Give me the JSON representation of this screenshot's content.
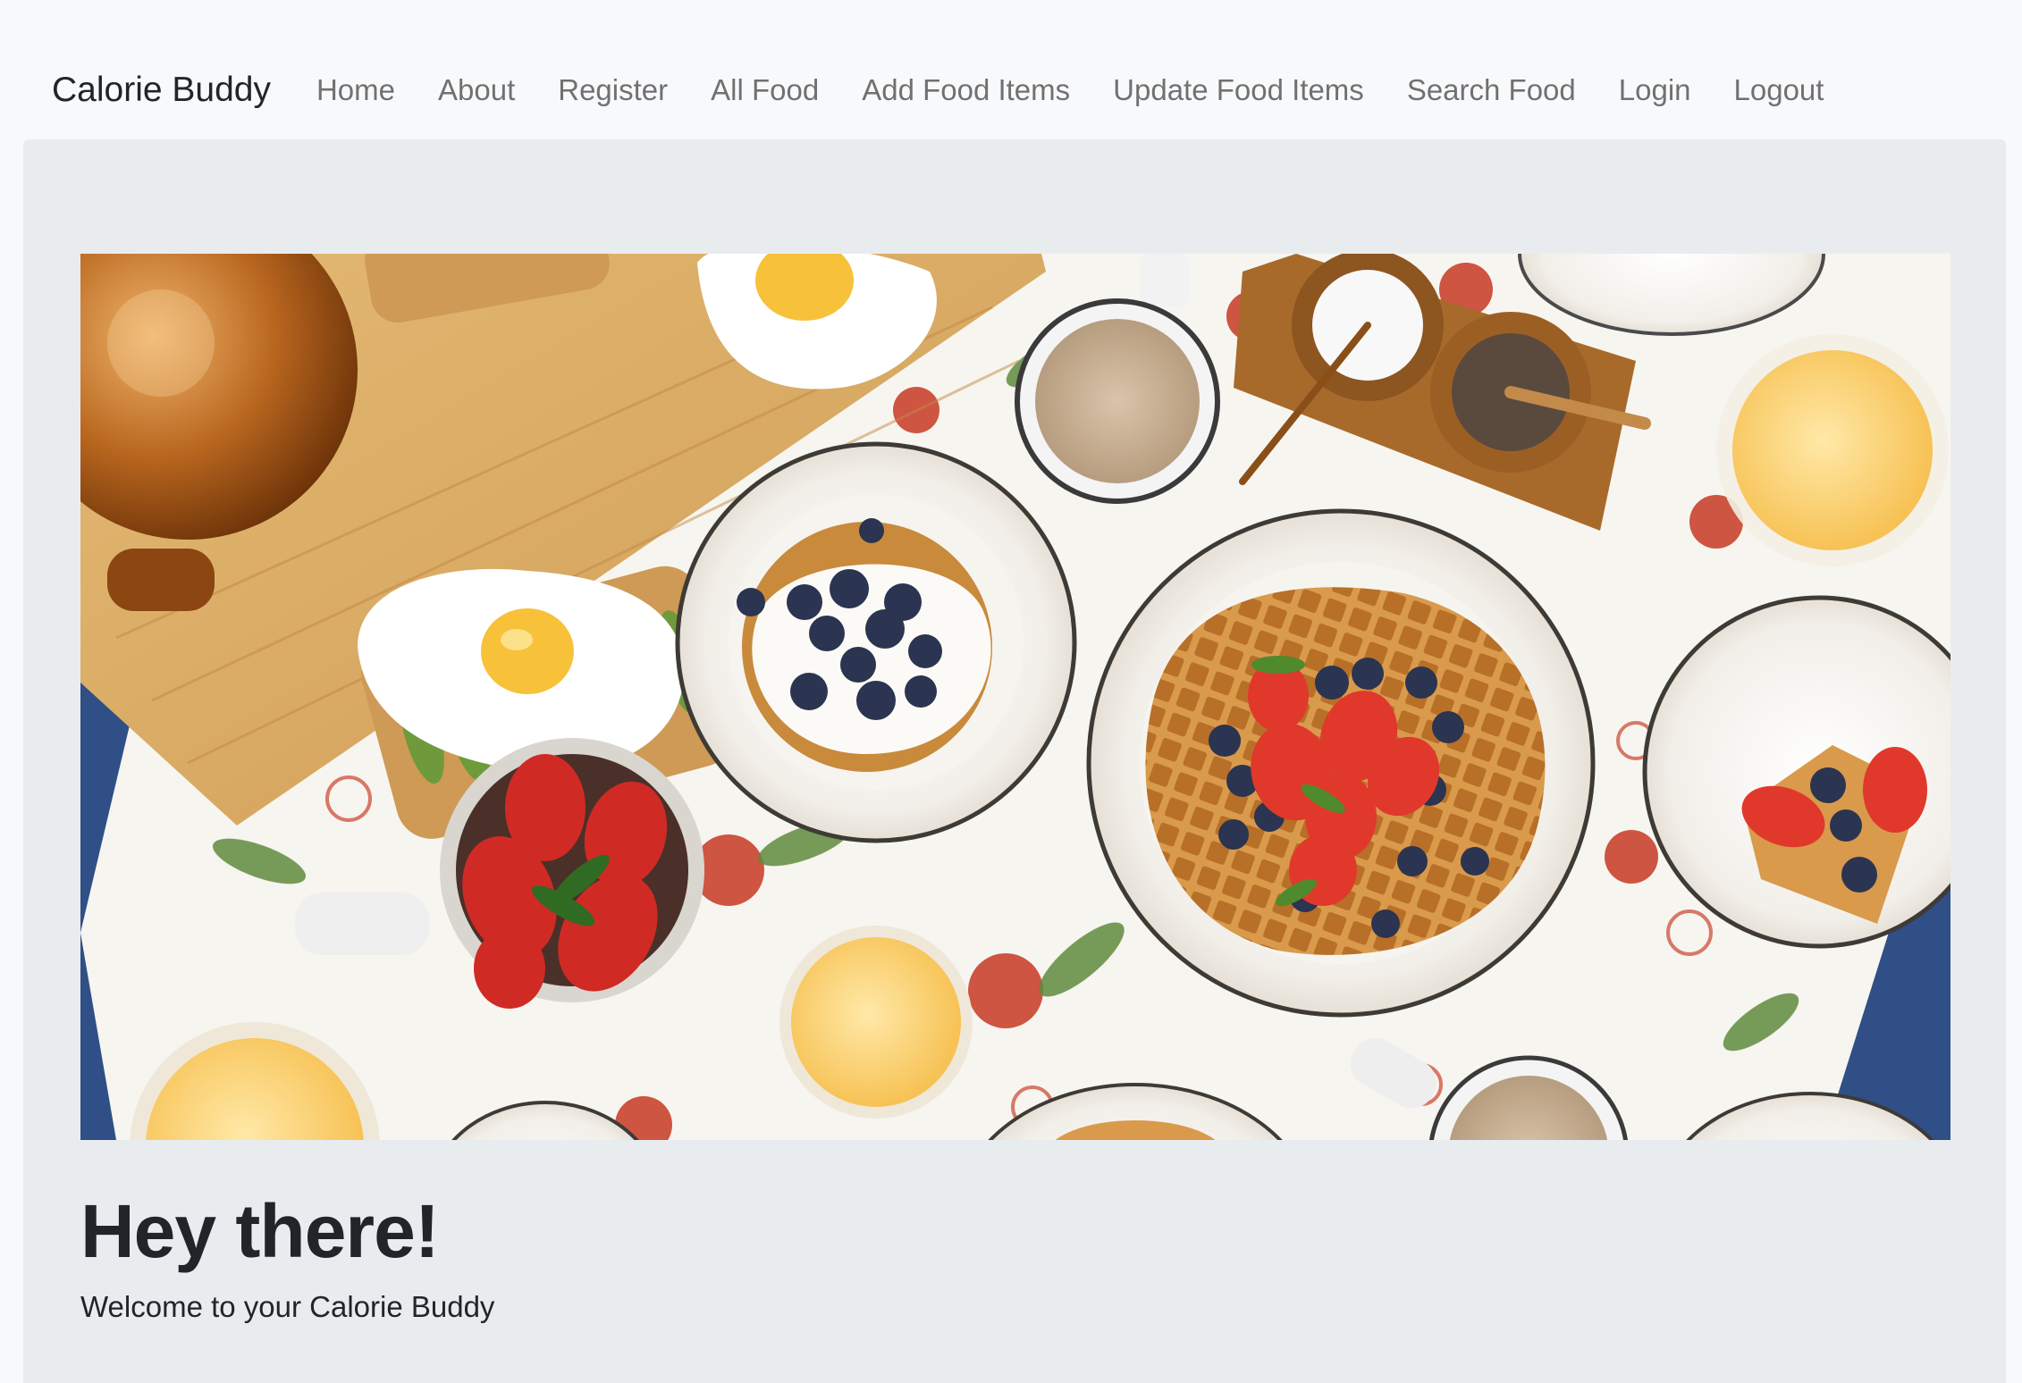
{
  "navbar": {
    "brand": "Calorie Buddy",
    "links": [
      {
        "label": "Home"
      },
      {
        "label": "About"
      },
      {
        "label": "Register"
      },
      {
        "label": "All Food"
      },
      {
        "label": "Add Food Items"
      },
      {
        "label": "Update Food Items"
      },
      {
        "label": "Search Food"
      },
      {
        "label": "Login"
      },
      {
        "label": "Logout"
      }
    ]
  },
  "hero": {
    "heading": "Hey there!",
    "subtext": "Welcome to your Calorie Buddy"
  }
}
